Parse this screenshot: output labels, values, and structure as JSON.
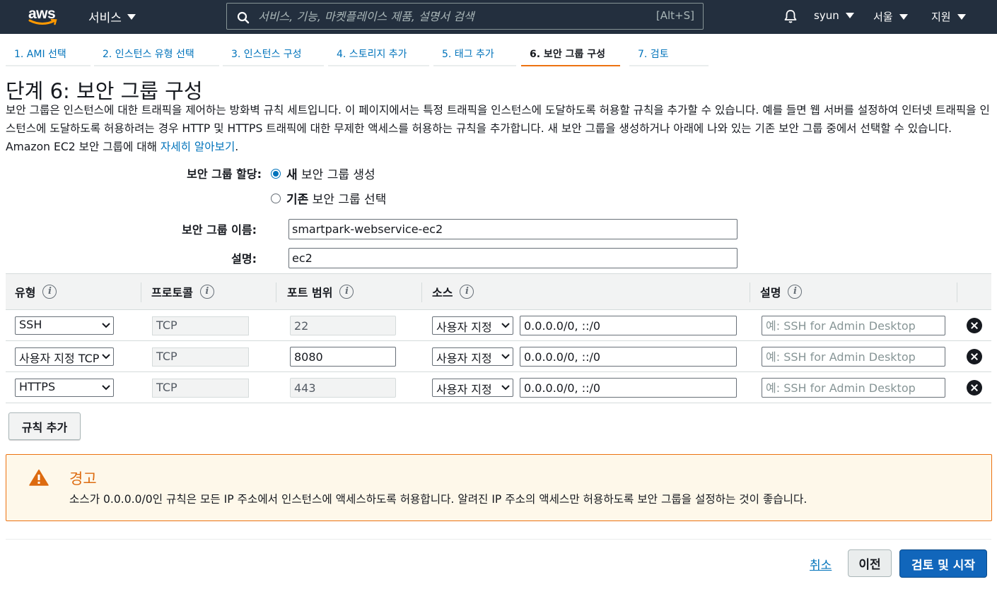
{
  "topnav": {
    "logo_text": "aws",
    "services": "서비스",
    "search_placeholder": "서비스, 기능, 마켓플레이스 제품, 설명서 검색",
    "search_hint": "[Alt+S]",
    "user": "syun",
    "region": "서울",
    "support": "지원",
    "colors": {
      "bg": "#232f3e",
      "smile": "#ff9900"
    }
  },
  "steps": [
    {
      "label": "1. AMI 선택"
    },
    {
      "label": "2. 인스턴스 유형 선택"
    },
    {
      "label": "3. 인스턴스 구성"
    },
    {
      "label": "4. 스토리지 추가"
    },
    {
      "label": "5. 태그 추가"
    },
    {
      "label": "6. 보안 그룹 구성",
      "active": true
    },
    {
      "label": "7. 검토"
    }
  ],
  "page": {
    "title": "단계 6: 보안 그룹 구성",
    "intro": "보안 그룹은 인스턴스에 대한 트래픽을 제어하는 방화벽 규칙 세트입니다. 이 페이지에서는 특정 트래픽을 인스턴스에 도달하도록 허용할 규칙을 추가할 수 있습니다. 예를 들면 웹 서버를 설정하여 인터넷 트래픽을 인스턴스에 도달하도록 허용하려는 경우 HTTP 및 HTTPS 트래픽에 대한 무제한 액세스를 허용하는 규칙을 추가합니다. 새 보안 그룹을 생성하거나 아래에 나와 있는 기존 보안 그룹 중에서 선택할 수 있습니다. Amazon EC2 보안 그룹에 대해 ",
    "learn_more": "자세히 알아보기",
    "period": "."
  },
  "assignment": {
    "label": "보안 그룹 할당:",
    "option_new_bold": "새",
    "option_new_rest": " 보안 그룹 생성",
    "option_existing_bold": "기존",
    "option_existing_rest": " 보안 그룹 선택",
    "selected": "new"
  },
  "form": {
    "name_label": "보안 그룹 이름:",
    "name_value": "smartpark-webservice-ec2",
    "desc_label": "설명:",
    "desc_value": "ec2"
  },
  "table": {
    "headers": {
      "type": "유형",
      "protocol": "프로토콜",
      "port": "포트 범위",
      "source": "소스",
      "description": "설명"
    },
    "rows": [
      {
        "type": "SSH",
        "protocol": "TCP",
        "port": "22",
        "port_editable": false,
        "source_type": "사용자 지정",
        "source": "0.0.0.0/0, ::/0",
        "desc_placeholder": "예: SSH for Admin Desktop"
      },
      {
        "type": "사용자 지정 TCP",
        "protocol": "TCP",
        "port": "8080",
        "port_editable": true,
        "source_type": "사용자 지정",
        "source": "0.0.0.0/0, ::/0",
        "desc_placeholder": "예: SSH for Admin Desktop"
      },
      {
        "type": "HTTPS",
        "protocol": "TCP",
        "port": "443",
        "port_editable": false,
        "source_type": "사용자 지정",
        "source": "0.0.0.0/0, ::/0",
        "desc_placeholder": "예: SSH for Admin Desktop"
      }
    ],
    "add_rule": "규칙 추가"
  },
  "warning": {
    "title": "경고",
    "text": "소스가 0.0.0.0/0인 규칙은 모든 IP 주소에서 인스턴스에 액세스하도록 허용합니다. 알려진 IP 주소의 액세스만 허용하도록 보안 그룹을 설정하는 것이 좋습니다.",
    "color": "#ec7211"
  },
  "footer": {
    "cancel": "취소",
    "previous": "이전",
    "launch": "검토 및 시작"
  }
}
